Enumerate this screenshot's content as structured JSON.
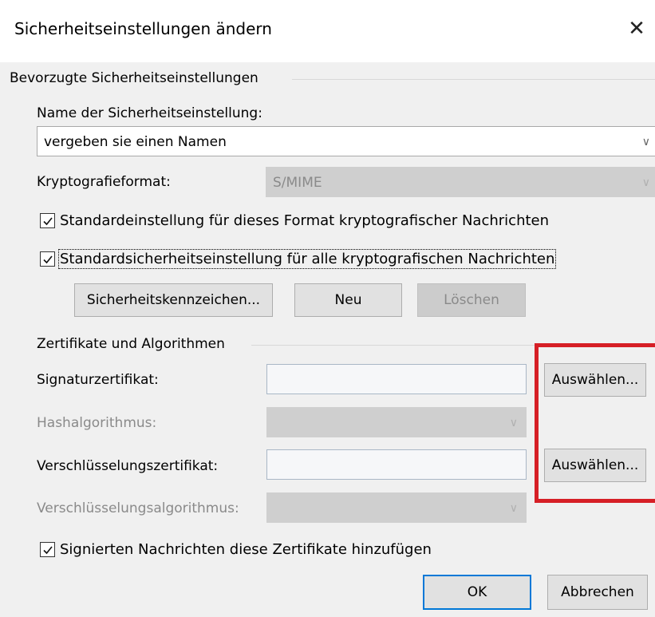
{
  "dialog": {
    "title": "Sicherheitseinstellungen ändern",
    "close_glyph": "✕"
  },
  "preferred": {
    "group_label": "Bevorzugte Sicherheitseinstellungen",
    "name_label": "Name der Sicherheitseinstellung:",
    "name_value": "vergeben sie einen Namen",
    "crypto_label": "Kryptografieformat:",
    "crypto_value": "S/MIME",
    "checkbox1_label": "Standardeinstellung für dieses Format kryptografischer Nachrichten",
    "checkbox1_checked": true,
    "checkbox2_label": "Standardsicherheitseinstellung für alle kryptografischen Nachrichten",
    "checkbox2_checked": true,
    "btn_labels": "Sicherheitskennzeichen...",
    "btn_new": "Neu",
    "btn_delete": "Löschen"
  },
  "certs": {
    "group_label": "Zertifikate und Algorithmen",
    "sign_cert_label": "Signaturzertifikat:",
    "sign_cert_value": "",
    "hash_label": "Hashalgorithmus:",
    "hash_value": "",
    "enc_cert_label": "Verschlüsselungszertifikat:",
    "enc_cert_value": "",
    "enc_alg_label": "Verschlüsselungsalgorithmus:",
    "enc_alg_value": "",
    "choose1": "Auswählen...",
    "choose2": "Auswählen...",
    "attach_label": "Signierten Nachrichten diese Zertifikate hinzufügen",
    "attach_checked": true
  },
  "footer": {
    "ok": "OK",
    "cancel": "Abbrechen"
  },
  "colors": {
    "highlight_box": "#d61f26",
    "default_button_border": "#0078d7",
    "dialog_bg": "#f0f0f0"
  },
  "icons": {
    "close": "close-icon",
    "check": "checkmark-icon",
    "chevron": "chevron-down-icon"
  }
}
